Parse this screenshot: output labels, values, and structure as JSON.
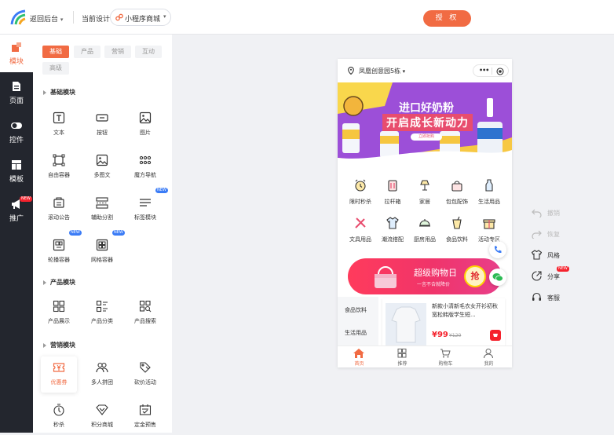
{
  "topbar": {
    "back_label": "返回后台",
    "current_design_label": "当前设计",
    "current_design_value": "小程序商城",
    "auth_label": "授 权"
  },
  "rail": {
    "items": [
      {
        "label": "模块",
        "icon": "puzzle-icon",
        "active": true
      },
      {
        "label": "页面",
        "icon": "page-icon"
      },
      {
        "label": "控件",
        "icon": "toggle-icon"
      },
      {
        "label": "模板",
        "icon": "template-icon"
      },
      {
        "label": "推广",
        "icon": "megaphone-icon",
        "badge": "NEW"
      }
    ]
  },
  "panel": {
    "tabs": [
      "基础",
      "产品",
      "营销",
      "互动",
      "高级"
    ],
    "sections": {
      "basic": {
        "title": "基础模块",
        "items": [
          {
            "label": "文本",
            "icon": "text-icon"
          },
          {
            "label": "按钮",
            "icon": "button-icon"
          },
          {
            "label": "图片",
            "icon": "image-icon"
          },
          {
            "label": "自由容器",
            "icon": "free-container-icon"
          },
          {
            "label": "多图文",
            "icon": "multi-image-text-icon"
          },
          {
            "label": "魔方导航",
            "icon": "cube-nav-icon"
          },
          {
            "label": "滚动公告",
            "icon": "notice-icon"
          },
          {
            "label": "辅助分割",
            "icon": "divider-icon"
          },
          {
            "label": "标签模块",
            "icon": "tag-module-icon",
            "badge": "NEW"
          },
          {
            "label": "轮播容器",
            "icon": "carousel-icon",
            "badge": "NEW"
          },
          {
            "label": "网格容器",
            "icon": "grid-container-icon",
            "badge": "NEW"
          }
        ]
      },
      "product": {
        "title": "产品模块",
        "items": [
          {
            "label": "产品展示",
            "icon": "product-display-icon"
          },
          {
            "label": "产品分类",
            "icon": "product-category-icon"
          },
          {
            "label": "产品搜索",
            "icon": "product-search-icon"
          }
        ]
      },
      "marketing": {
        "title": "营销模块",
        "items": [
          {
            "label": "优惠券",
            "icon": "coupon-icon",
            "active": true
          },
          {
            "label": "多人拼团",
            "icon": "group-buy-icon"
          },
          {
            "label": "砍价活动",
            "icon": "bargain-icon"
          },
          {
            "label": "秒杀",
            "icon": "flash-sale-icon"
          },
          {
            "label": "积分商城",
            "icon": "points-mall-icon"
          },
          {
            "label": "定金预售",
            "icon": "presale-icon"
          }
        ]
      }
    }
  },
  "phone": {
    "location": "凤凰创意园5栋",
    "banner": {
      "line1": "进口好奶粉",
      "line2": "开启成长新动力",
      "button": "立即抢购"
    },
    "nav": [
      {
        "label": "限时秒杀",
        "icon": "alarm-clock-icon"
      },
      {
        "label": "拉杆箱",
        "icon": "suitcase-icon"
      },
      {
        "label": "家居",
        "icon": "lamp-icon"
      },
      {
        "label": "包包配饰",
        "icon": "bag-icon"
      },
      {
        "label": "生活用品",
        "icon": "bottle-icon"
      },
      {
        "label": "文具用品",
        "icon": "stationery-icon"
      },
      {
        "label": "潮流搭配",
        "icon": "shirt-icon"
      },
      {
        "label": "厨房用品",
        "icon": "cloche-icon"
      },
      {
        "label": "食品饮料",
        "icon": "drink-icon"
      },
      {
        "label": "活动专区",
        "icon": "gift-icon"
      }
    ],
    "promo": {
      "title": "超级购物日",
      "subtitle": "一言不合就降价",
      "button": "抢"
    },
    "categories": [
      "食品饮料",
      "生活用品"
    ],
    "product": {
      "name": "新款小清新毛衣女开衫初秋宽松韩版学生短...",
      "price": "¥99",
      "old_price": "¥120"
    },
    "tabbar": [
      {
        "label": "首页",
        "icon": "home-icon",
        "active": true
      },
      {
        "label": "推荐",
        "icon": "grid-icon"
      },
      {
        "label": "购物车",
        "icon": "cart-icon"
      },
      {
        "label": "我的",
        "icon": "user-icon"
      }
    ]
  },
  "side_tools": [
    {
      "label": "撤销",
      "icon": "undo-icon",
      "disabled": true
    },
    {
      "label": "恢复",
      "icon": "redo-icon",
      "disabled": true
    },
    {
      "label": "风格",
      "icon": "tshirt-icon"
    },
    {
      "label": "分享",
      "icon": "share-icon",
      "badge": "NEW"
    },
    {
      "label": "客服",
      "icon": "headset-icon"
    }
  ],
  "colors": {
    "accent": "#f16b43",
    "rail_bg": "#23262e",
    "canvas_bg": "#f0f1f4",
    "promo_red": "#f0346a",
    "price_red": "#f5222d"
  }
}
